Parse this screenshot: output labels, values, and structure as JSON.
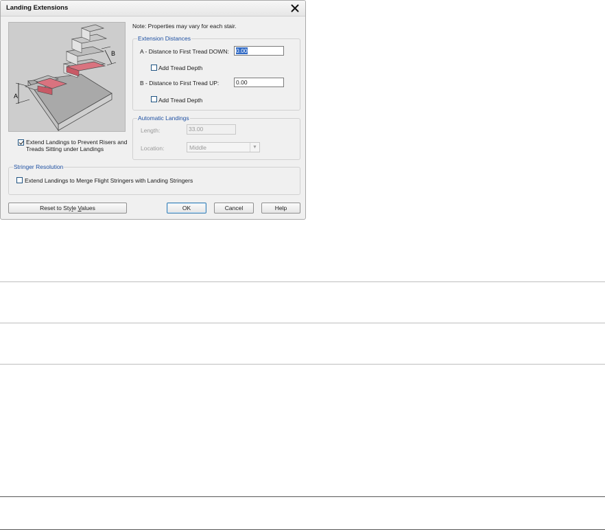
{
  "dialog": {
    "title": "Landing Extensions",
    "note": "Note: Properties may vary for each stair.",
    "illustration": {
      "label_a": "A",
      "label_b": "B"
    },
    "extend_prevent": {
      "line1": "Extend Landings to Prevent Risers and",
      "line2": "Treads Sitting under Landings",
      "checked": true
    },
    "extension_distances": {
      "title": "Extension Distances",
      "a_label": "A - Distance to First Tread DOWN:",
      "a_value": "0.00",
      "a_add_tread": "Add Tread Depth",
      "b_label": "B - Distance to First Tread UP:",
      "b_value": "0.00",
      "b_add_tread": "Add Tread Depth"
    },
    "automatic_landings": {
      "title": "Automatic Landings",
      "length_label": "Length:",
      "length_value": "33.00",
      "location_label": "Location:",
      "location_value": "Middle"
    },
    "stringer_resolution": {
      "title": "Stringer Resolution",
      "merge_label": "Extend Landings to Merge Flight Stringers with Landing Stringers"
    },
    "buttons": {
      "reset_prefix": "Reset to Sty",
      "reset_underlined": "l",
      "reset_middle": "e ",
      "reset_underlined2": "V",
      "reset_suffix": "alues",
      "ok": "OK",
      "cancel": "Cancel",
      "help": "Help"
    }
  }
}
